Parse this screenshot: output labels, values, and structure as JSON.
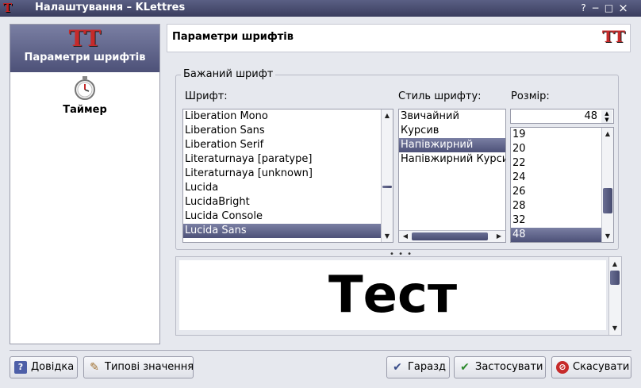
{
  "window": {
    "title": "Налаштування – KLettres",
    "controls": [
      "?",
      "−",
      "□",
      "×"
    ]
  },
  "sidebar": {
    "items": [
      {
        "label": "Параметри шрифтів",
        "icon": "font-tt-icon",
        "icon_glyph": "TT",
        "selected": true
      },
      {
        "label": "Таймер",
        "icon": "stopwatch-icon",
        "selected": false
      }
    ]
  },
  "header": {
    "title": "Параметри шрифтів",
    "icon_glyph": "TT"
  },
  "font_group": {
    "title": "Бажаний шрифт",
    "font_label": "Шрифт:",
    "style_label": "Стиль шрифту:",
    "size_label": "Розмір:",
    "fonts": [
      {
        "name": "Liberation Mono",
        "selected": false
      },
      {
        "name": "Liberation Sans",
        "selected": false
      },
      {
        "name": "Liberation Serif",
        "selected": false
      },
      {
        "name": "Literaturnaya [paratype]",
        "selected": false
      },
      {
        "name": "Literaturnaya [unknown]",
        "selected": false
      },
      {
        "name": "Lucida",
        "selected": false
      },
      {
        "name": "LucidaBright",
        "selected": false
      },
      {
        "name": "Lucida Console",
        "selected": false
      },
      {
        "name": "Lucida Sans",
        "selected": true
      }
    ],
    "styles": [
      {
        "name": "Звичайний",
        "selected": false
      },
      {
        "name": "Курсив",
        "selected": false
      },
      {
        "name": "Напівжирний",
        "selected": true
      },
      {
        "name": "Напівжирний Курсив",
        "selected": false
      }
    ],
    "size_value": "48",
    "sizes": [
      {
        "name": "19",
        "selected": false
      },
      {
        "name": "20",
        "selected": false
      },
      {
        "name": "22",
        "selected": false
      },
      {
        "name": "24",
        "selected": false
      },
      {
        "name": "26",
        "selected": false
      },
      {
        "name": "28",
        "selected": false
      },
      {
        "name": "32",
        "selected": false
      },
      {
        "name": "48",
        "selected": true
      }
    ]
  },
  "preview": {
    "text": "Тест"
  },
  "buttons": {
    "help": "Довідка",
    "defaults": "Типові значення",
    "ok": "Гаразд",
    "apply": "Застосувати",
    "cancel": "Скасувати"
  },
  "colors": {
    "selection": "#5a5f84",
    "titlebar": "#3a3d5e",
    "accent_red": "#c62a2a"
  }
}
